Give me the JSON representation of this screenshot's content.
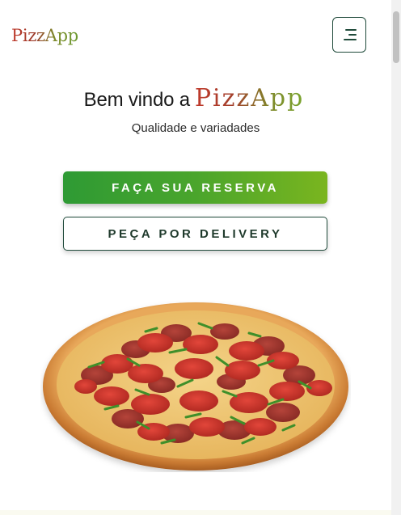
{
  "header": {
    "logo_text": "PizzApp",
    "menu_icon": "menu-icon"
  },
  "hero": {
    "welcome_prefix": "Bem vindo a",
    "brand_name": "PizzApp",
    "subtitle": "Qualidade e variadades"
  },
  "actions": {
    "reserve_label": "FAÇA SUA RESERVA",
    "delivery_label": "PEÇA POR DELIVERY"
  },
  "colors": {
    "brand_red": "#c0392b",
    "brand_green": "#6b9a2e",
    "primary_button": "#3a9e2f",
    "outline": "#1f4a3a"
  }
}
